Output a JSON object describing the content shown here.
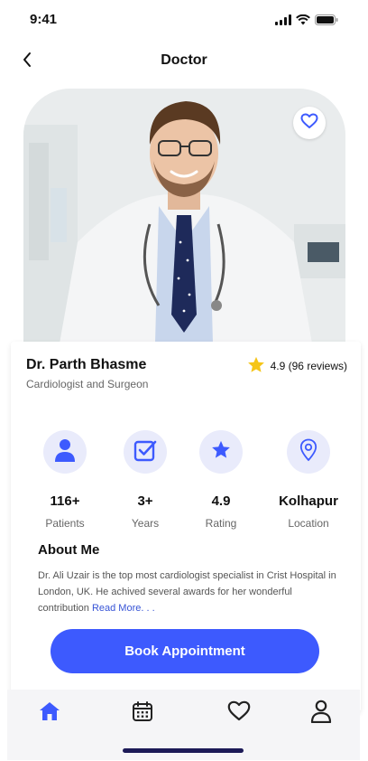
{
  "status_bar": {
    "time": "9:41"
  },
  "header": {
    "title": "Doctor"
  },
  "doctor": {
    "name": "Dr. Parth Bhasme",
    "specialty": "Cardiologist and Surgeon",
    "rating_text": "4.9 (96 reviews)"
  },
  "stats": [
    {
      "icon": "person-icon",
      "value": "116+",
      "label": "Patients"
    },
    {
      "icon": "checkbox-icon",
      "value": "3+",
      "label": "Years"
    },
    {
      "icon": "star-icon",
      "value": "4.9",
      "label": "Rating"
    },
    {
      "icon": "location-pin-icon",
      "value": "Kolhapur",
      "label": "Location"
    }
  ],
  "about": {
    "title": "About Me",
    "text": "Dr. Ali Uzair is the top most cardiologist specialist in Crist Hospital in London, UK. He achived several awards for her wonderful contribution",
    "read_more": "Read More. . ."
  },
  "actions": {
    "book_label": "Book Appointment"
  },
  "nav": [
    {
      "icon": "home-icon",
      "active": true
    },
    {
      "icon": "calendar-icon",
      "active": false
    },
    {
      "icon": "heart-icon",
      "active": false
    },
    {
      "icon": "profile-icon",
      "active": false
    }
  ],
  "colors": {
    "accent": "#3d5afe",
    "icon_bg": "#e9ebfb",
    "star": "#f5c518",
    "text_muted": "#666666"
  }
}
